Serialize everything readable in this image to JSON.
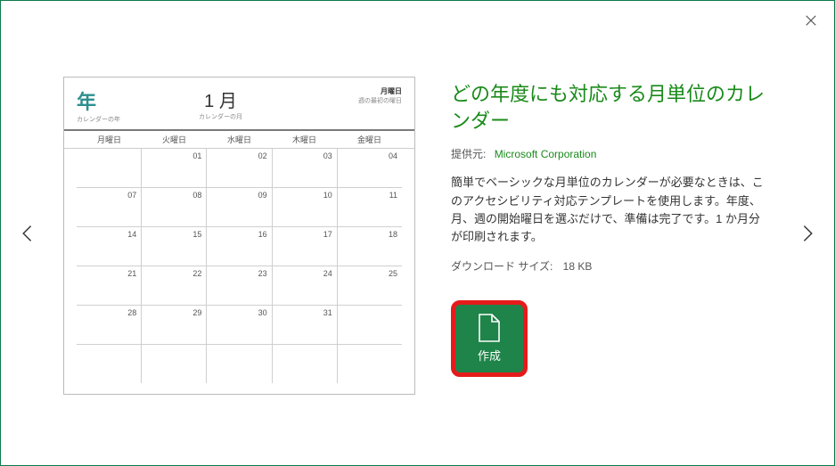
{
  "close_aria": "閉じる",
  "nav": {
    "prev": "prev",
    "next": "next"
  },
  "preview": {
    "year_label": "年",
    "year_sub": "カレンダーの年",
    "month_label": "1 月",
    "month_sub": "カレンダーの月",
    "right_label": "月曜日",
    "right_sub": "週の最初の曜日",
    "dow": [
      "月曜日",
      "火曜日",
      "水曜日",
      "木曜日",
      "金曜日"
    ],
    "rows": [
      [
        "",
        "01",
        "02",
        "03",
        "04"
      ],
      [
        "07",
        "08",
        "09",
        "10",
        "11"
      ],
      [
        "14",
        "15",
        "16",
        "17",
        "18"
      ],
      [
        "21",
        "22",
        "23",
        "24",
        "25"
      ],
      [
        "28",
        "29",
        "30",
        "31",
        ""
      ],
      [
        "",
        "",
        "",
        "",
        ""
      ]
    ]
  },
  "info": {
    "title": "どの年度にも対応する月単位のカレンダー",
    "provider_label": "提供元:",
    "provider_name": "Microsoft Corporation",
    "description": "簡単でベーシックな月単位のカレンダーが必要なときは、このアクセシビリティ対応テンプレートを使用します。年度、月、週の開始曜日を選ぶだけで、準備は完了です。1 か月分が印刷されます。",
    "size_label": "ダウンロード サイズ:",
    "size_value": "18 KB",
    "create_label": "作成"
  }
}
